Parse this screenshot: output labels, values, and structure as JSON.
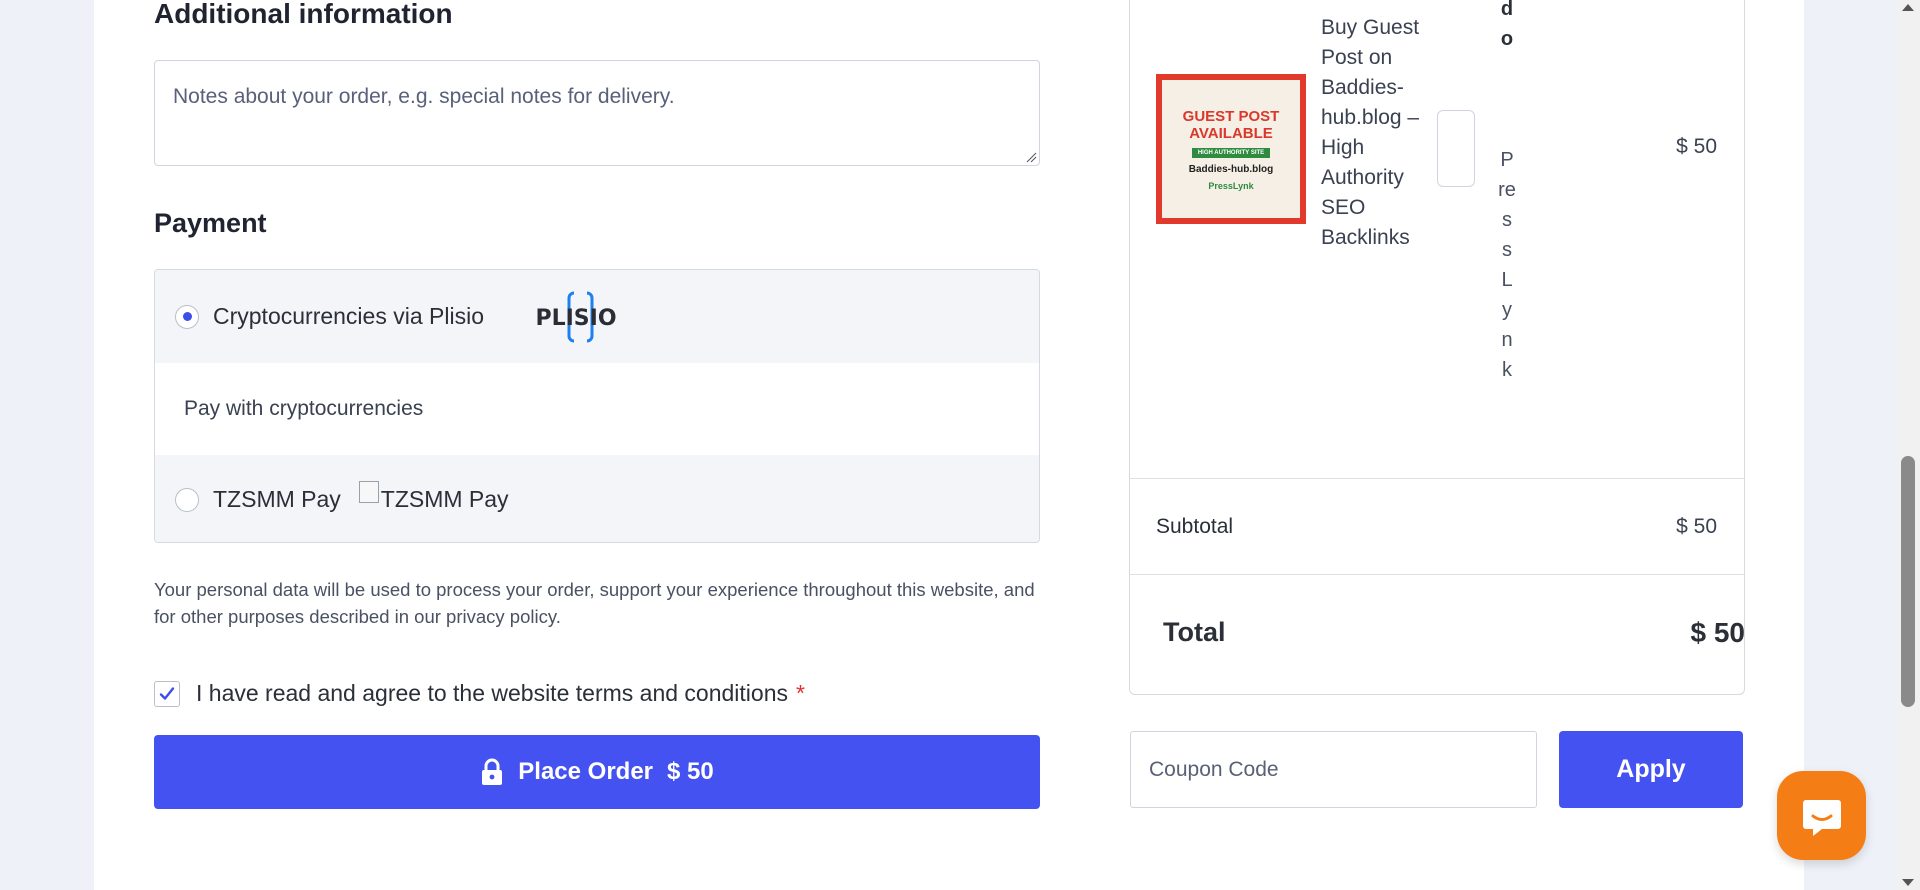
{
  "checkout": {
    "additional_info_title": "Additional information",
    "notes_placeholder": "Notes about your order, e.g. special notes for delivery.",
    "payment_title": "Payment",
    "payment_methods": [
      {
        "label": "Cryptocurrencies via Plisio",
        "logo_text": "PLISIO",
        "selected": true,
        "description": "Pay with cryptocurrencies"
      },
      {
        "label": "TZSMM Pay",
        "logo_alt": "TZSMM Pay",
        "selected": false
      }
    ],
    "privacy_text": "Your personal data will be used to process your order, support your experience throughout this website, and for other purposes described in our privacy policy.",
    "terms_label": "I have read and agree to the website terms and conditions",
    "terms_required_mark": "*",
    "place_order_label": "Place Order",
    "place_order_amount": "$ 50"
  },
  "order_summary": {
    "product_name": "Buy Guest Post on Baddies-hub.blog – High Authority SEO Backlinks",
    "product_image": {
      "line1": "GUEST POST",
      "line2": "AVAILABLE",
      "tag": "HIGH AUTHORITY SITE",
      "site": "Baddies-hub.blog",
      "brand": "PressLynk"
    },
    "vendor_label_visible": "dor:",
    "vendor_name": "PressLynk",
    "line_price": "$ 50",
    "subtotal_label": "Subtotal",
    "subtotal_value": "$ 50",
    "total_label": "Total",
    "total_value": "$ 50",
    "coupon_placeholder": "Coupon Code",
    "apply_label": "Apply"
  },
  "colors": {
    "accent": "#4452f2",
    "chat_bubble": "#f57d15",
    "required": "#e03131",
    "product_red": "#e13a2d"
  },
  "icons": {
    "lock": "lock-icon",
    "chat": "chat-icon",
    "check": "checkmark-icon"
  }
}
